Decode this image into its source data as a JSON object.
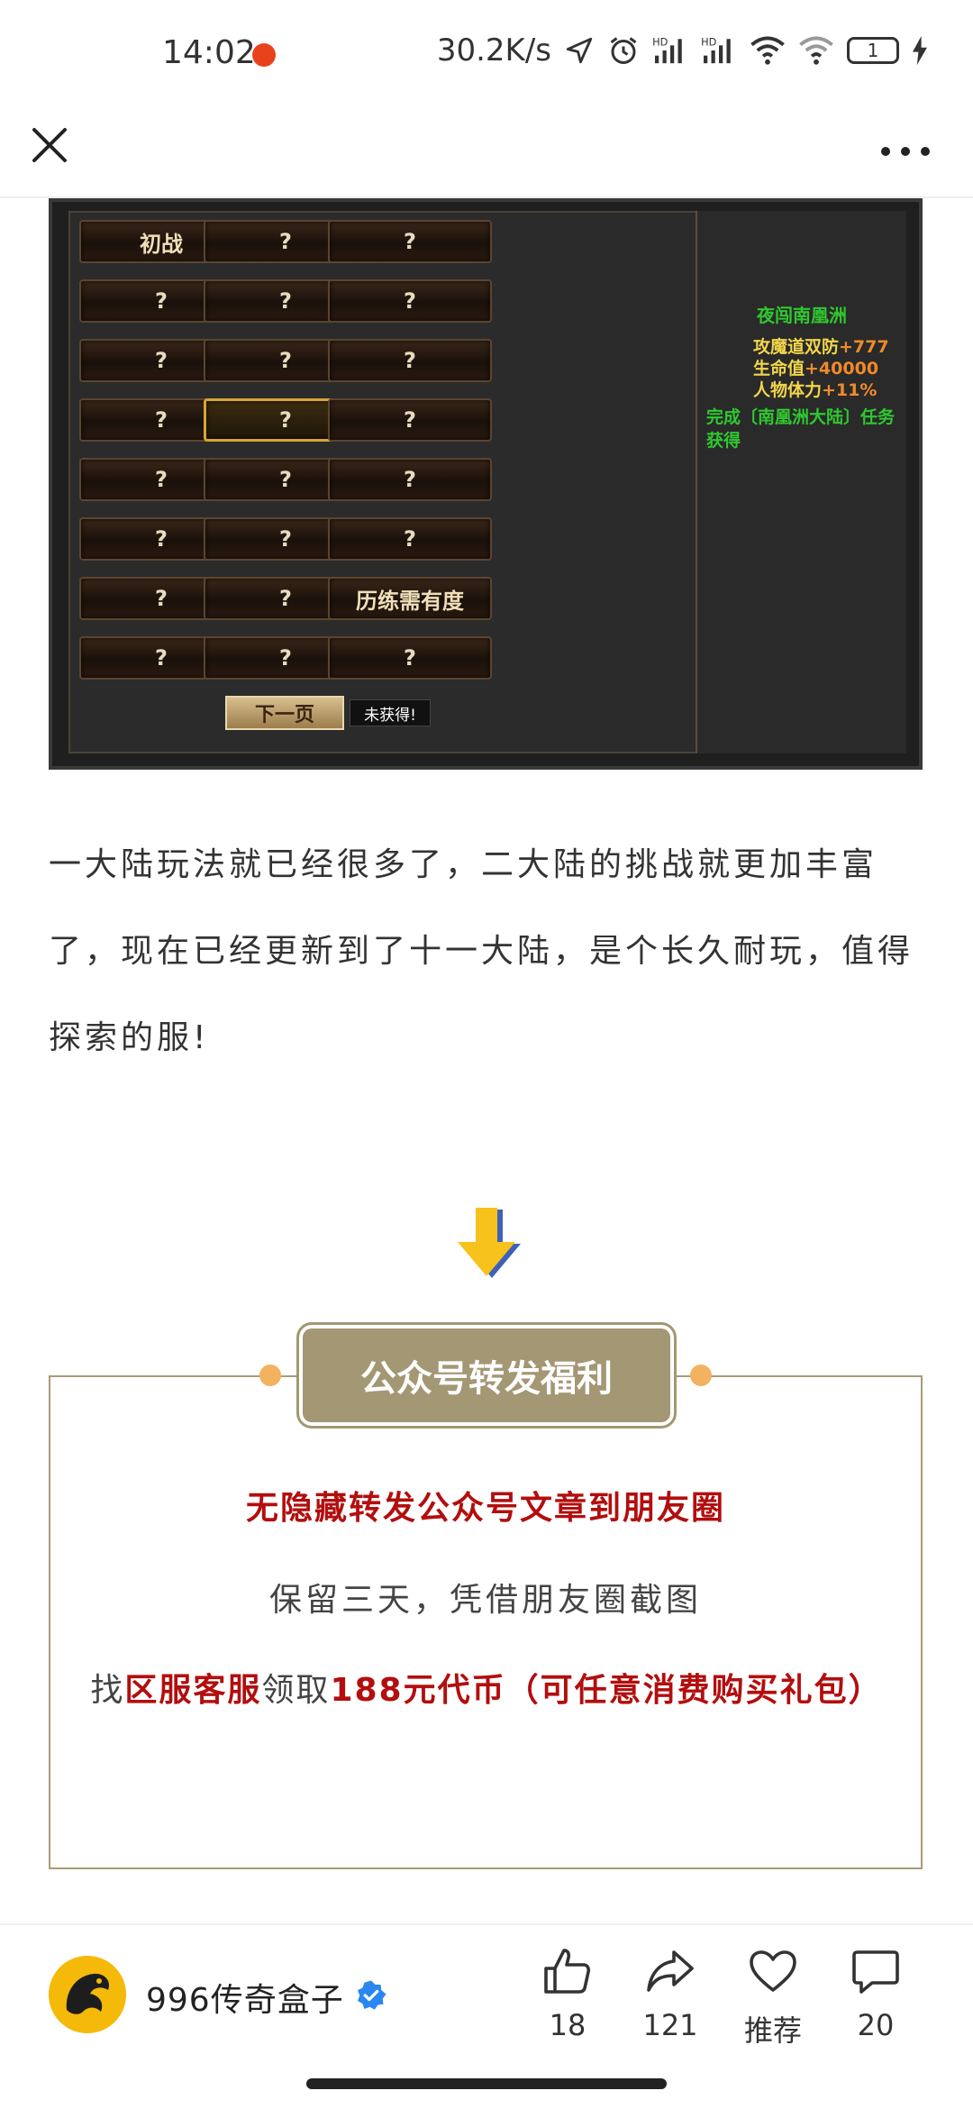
{
  "status_bar": {
    "time": "14:02",
    "network_speed": "30.2K/s",
    "battery_level": "1",
    "icons": [
      "notification-icon",
      "location-icon",
      "alarm-icon",
      "signal-hd-icon",
      "signal-hd-icon",
      "wifi-icon",
      "wifi-6-icon",
      "battery-icon",
      "charging-icon"
    ]
  },
  "nav": {
    "close_icon": "close-icon",
    "more_icon": "more-icon"
  },
  "game_panel": {
    "cells": [
      [
        "初战",
        "?",
        "?"
      ],
      [
        "?",
        "?",
        "?"
      ],
      [
        "?",
        "?",
        "?"
      ],
      [
        "?",
        "?",
        "?"
      ],
      [
        "?",
        "?",
        "?"
      ],
      [
        "?",
        "?",
        "?"
      ],
      [
        "?",
        "?",
        "历练需有度"
      ],
      [
        "?",
        "?",
        "?"
      ]
    ],
    "info": {
      "title": "夜闯南凰洲",
      "stat1_label": "攻魔道双防",
      "stat1_value": "+777",
      "stat2_label": "生命值",
      "stat2_value": "+40000",
      "stat3_label": "人物体力",
      "stat3_value": "+11%",
      "quest": "完成〔南凰洲大陆〕任务获得"
    },
    "next_page": "下一页",
    "not_obtained": "未获得!"
  },
  "article": {
    "paragraph": "一大陆玩法就已经很多了，二大陆的挑战就更加丰富了，现在已经更新到了十一大陆，是个长久耐玩，值得探索的服!"
  },
  "benefit": {
    "header": "公众号转发福利",
    "line1": "无隐藏转发公众号文章到朋友圈",
    "line2": "保留三天，凭借朋友圈截图",
    "line3_prefix": "找",
    "line3_highlight1": "区服客服",
    "line3_middle": "领取",
    "line3_highlight2": "188元代币（可任意消费购买礼包）"
  },
  "footer": {
    "account_name": "996传奇盒子",
    "like_count": "18",
    "share_count": "121",
    "recommend_label": "推荐",
    "comment_count": "20"
  }
}
